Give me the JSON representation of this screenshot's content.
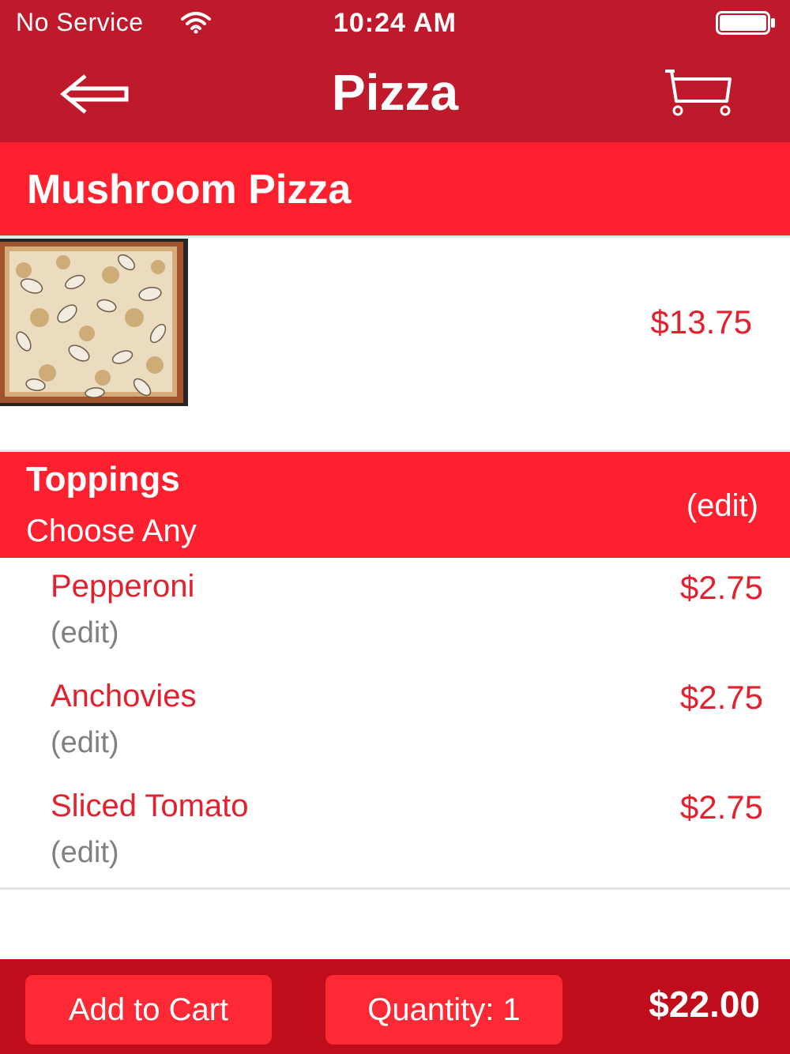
{
  "status_bar": {
    "carrier": "No Service",
    "time": "10:24 AM",
    "wifi_icon": "wifi-icon",
    "battery_icon": "battery-icon"
  },
  "nav": {
    "title": "Pizza",
    "back_icon": "arrow-left-icon",
    "cart_icon": "shopping-cart-icon"
  },
  "item": {
    "name": "Mushroom Pizza",
    "price": "$13.75",
    "image": "mushroom-pizza-photo"
  },
  "toppings": {
    "title": "Toppings",
    "subtitle": "Choose Any",
    "edit_label": "(edit)",
    "items": [
      {
        "label": "Pepperoni",
        "edit": "(edit)",
        "price": "$2.75"
      },
      {
        "label": "Anchovies",
        "edit": "(edit)",
        "price": "$2.75"
      },
      {
        "label": "Sliced Tomato",
        "edit": "(edit)",
        "price": "$2.75"
      }
    ]
  },
  "footer": {
    "add_to_cart": "Add to Cart",
    "quantity": "Quantity: 1",
    "total": "$22.00"
  },
  "colors": {
    "nav_red": "#bf1a2b",
    "header_red": "#fd212f",
    "text_red": "#e3212e",
    "footer_red": "#bf0d1c",
    "button_red": "#fd2a35",
    "muted_gray": "#808080"
  }
}
